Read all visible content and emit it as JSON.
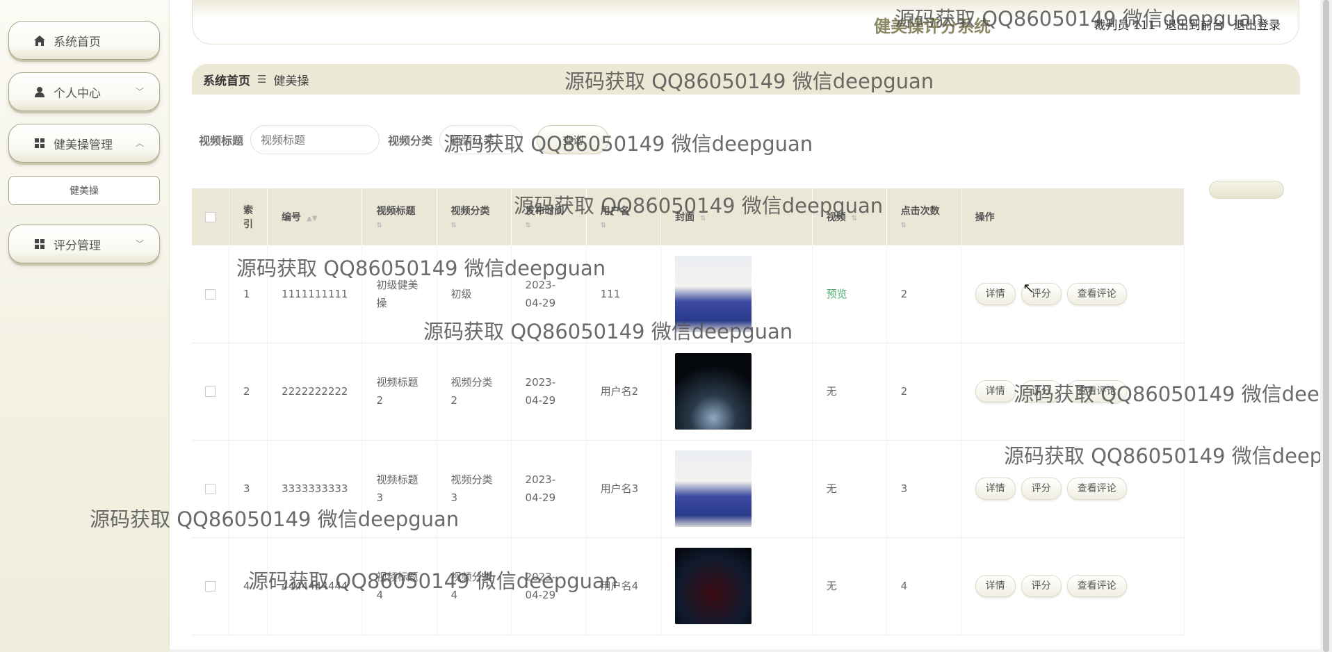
{
  "sidebar": {
    "items": [
      {
        "label": "系统首页",
        "icon": "home-icon"
      },
      {
        "label": "个人中心",
        "icon": "user-icon"
      },
      {
        "label": "健美操管理",
        "icon": "grid-icon"
      },
      {
        "label": "评分管理",
        "icon": "grid-icon"
      }
    ],
    "sub_items": [
      {
        "label": "健美操"
      }
    ]
  },
  "header": {
    "title": "健美操评分系统",
    "user_label": "裁判员 111",
    "exit_front": "退出到前台",
    "logout": "退出登录"
  },
  "breadcrumb": {
    "home": "系统首页",
    "separator": "☰",
    "current": "健美操"
  },
  "search": {
    "title_label": "视频标题",
    "title_placeholder": "视频标题",
    "category_label": "视频分类",
    "category_placeholder": "视频分类",
    "button": "查询"
  },
  "table": {
    "headers": {
      "index": "索引",
      "number": "编号",
      "title": "视频标题",
      "category": "视频分类",
      "date": "发布时间",
      "user": "用户名",
      "cover": "封面",
      "video": "视频",
      "clicks": "点击次数",
      "actions": "操作"
    },
    "rows": [
      {
        "index": "1",
        "number": "1111111111",
        "title": "初级健美操",
        "category": "初级",
        "date": "2023-04-29",
        "user": "111",
        "video": "预览",
        "clicks": "2"
      },
      {
        "index": "2",
        "number": "2222222222",
        "title": "视频标题2",
        "category": "视频分类2",
        "date": "2023-04-29",
        "user": "用户名2",
        "video": "无",
        "clicks": "2"
      },
      {
        "index": "3",
        "number": "3333333333",
        "title": "视频标题3",
        "category": "视频分类3",
        "date": "2023-04-29",
        "user": "用户名3",
        "video": "无",
        "clicks": "3"
      },
      {
        "index": "4",
        "number": "4444444444",
        "title": "视频标题4",
        "category": "视频分类4",
        "date": "2023-04-29",
        "user": "用户名4",
        "video": "无",
        "clicks": "4"
      }
    ],
    "action_labels": {
      "detail": "详情",
      "score": "评分",
      "comments": "查看评论"
    }
  },
  "watermark": "源码获取 QQ86050149 微信deepguan"
}
